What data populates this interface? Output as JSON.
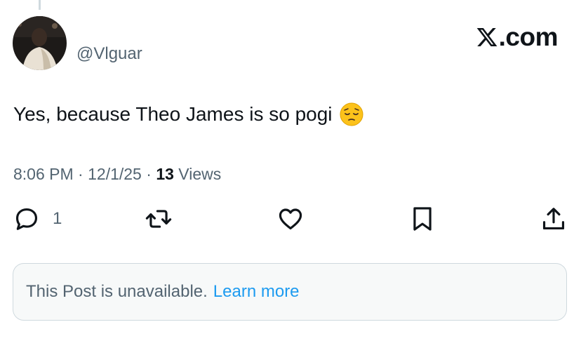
{
  "post": {
    "handle": "@Vlguar",
    "brand": ".com",
    "text": "Yes, because Theo James is so pogi",
    "emoji": "pensive-face-emoji",
    "time": "8:06 PM",
    "date": "12/1/25",
    "separator": "·",
    "views_count": "13",
    "views_label": "Views"
  },
  "actions": {
    "reply_count": "1",
    "reply_icon": "reply-icon",
    "repost_icon": "repost-icon",
    "like_icon": "heart-icon",
    "bookmark_icon": "bookmark-icon",
    "share_icon": "share-icon"
  },
  "notice": {
    "text": "This Post is unavailable.",
    "link": "Learn more"
  },
  "colors": {
    "text_primary": "#0f1419",
    "text_secondary": "#536471",
    "accent": "#1d9bf0",
    "border": "#cfd9de"
  }
}
